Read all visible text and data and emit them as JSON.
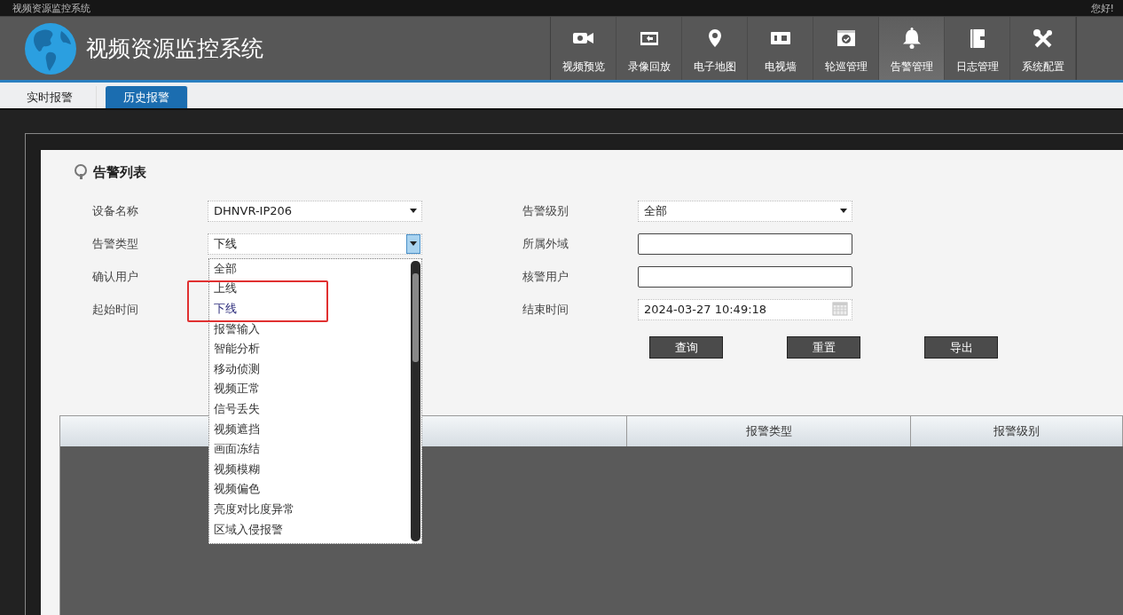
{
  "window": {
    "title": "视频资源监控系统",
    "greeting": "您好!"
  },
  "app": {
    "title": "视频资源监控系统"
  },
  "nav": [
    {
      "label": "视频预览",
      "selected": false
    },
    {
      "label": "录像回放",
      "selected": false
    },
    {
      "label": "电子地图",
      "selected": false
    },
    {
      "label": "电视墙",
      "selected": false
    },
    {
      "label": "轮巡管理",
      "selected": false
    },
    {
      "label": "告警管理",
      "selected": true
    },
    {
      "label": "日志管理",
      "selected": false
    },
    {
      "label": "系统配置",
      "selected": false
    }
  ],
  "tabs": [
    {
      "label": "实时报警",
      "selected": false
    },
    {
      "label": "历史报警",
      "selected": true
    }
  ],
  "panel": {
    "title": "告警列表"
  },
  "filters": [
    {
      "label": "设备名称",
      "kind": "select",
      "value": "DHNVR-IP206",
      "open": false
    },
    {
      "label": "告警级别",
      "kind": "select",
      "value": "全部",
      "open": false
    },
    {
      "label": "告警类型",
      "kind": "select",
      "value": "下线",
      "open": true
    },
    {
      "label": "所属外域",
      "kind": "input"
    },
    {
      "label": "确认用户",
      "kind": "covered"
    },
    {
      "label": "核警用户",
      "kind": "input"
    },
    {
      "label": "起始时间",
      "kind": "covered"
    },
    {
      "label": "结束时间",
      "kind": "date",
      "value": "2024-03-27 10:49:18"
    }
  ],
  "dropdown": {
    "options": [
      {
        "label": "全部",
        "selected": false,
        "boxed": false
      },
      {
        "label": "上线",
        "selected": false,
        "boxed": true
      },
      {
        "label": "下线",
        "selected": true,
        "boxed": true
      },
      {
        "label": "报警输入",
        "selected": false,
        "boxed": false
      },
      {
        "label": "智能分析",
        "selected": false,
        "boxed": false
      },
      {
        "label": "移动侦测",
        "selected": false,
        "boxed": false
      },
      {
        "label": "视频正常",
        "selected": false,
        "boxed": false
      },
      {
        "label": "信号丢失",
        "selected": false,
        "boxed": false
      },
      {
        "label": "视频遮挡",
        "selected": false,
        "boxed": false
      },
      {
        "label": "画面冻结",
        "selected": false,
        "boxed": false
      },
      {
        "label": "视频模糊",
        "selected": false,
        "boxed": false
      },
      {
        "label": "视频偏色",
        "selected": false,
        "boxed": false
      },
      {
        "label": "亮度对比度异常",
        "selected": false,
        "boxed": false
      },
      {
        "label": "区域入侵报警",
        "selected": false,
        "boxed": false
      }
    ]
  },
  "buttons": [
    "查询",
    "重置",
    "导出"
  ],
  "table": {
    "columns": [
      "报警类型",
      "报警级别"
    ]
  }
}
